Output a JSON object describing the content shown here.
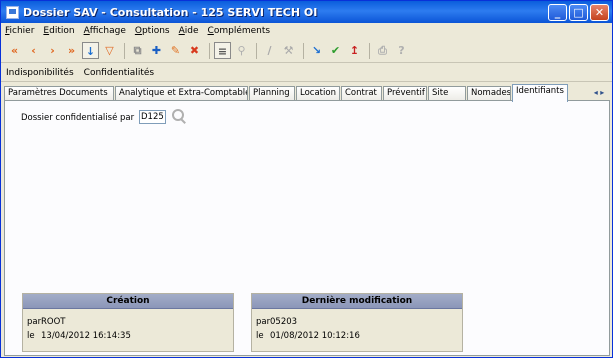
{
  "window": {
    "title": "Dossier SAV - Consultation - 125 SERVI TECH OI",
    "buttons": {
      "minimize": "_",
      "maximize": "□",
      "close": "✕"
    }
  },
  "menu": [
    "Fichier",
    "Edition",
    "Affichage",
    "Options",
    "Aide",
    "Compléments"
  ],
  "toolbar": {
    "icons": [
      "double-left-arrow-icon",
      "left-arrow-icon",
      "right-arrow-icon",
      "double-right-arrow-icon",
      "sort-icon",
      "filter-icon",
      "copy-icon",
      "add-icon",
      "edit-icon",
      "delete-icon",
      "list-icon",
      "lock-icon",
      "link-icon",
      "tools-icon",
      "validate-icon",
      "check-icon",
      "pin-icon",
      "print-icon",
      "help-icon"
    ],
    "glyphs": [
      "«",
      "‹",
      "›",
      "»",
      "↓",
      "▽",
      "⧉",
      "✚",
      "✎",
      "✖",
      "≡",
      "⚲",
      "∕",
      "⚒",
      "↘",
      "✔",
      "↥",
      "⎙",
      "?"
    ]
  },
  "subtabs": [
    "Indisponibilités",
    "Confidentialités"
  ],
  "tabs": [
    "Paramètres Documents",
    "Analytique et Extra-Comptable",
    "Planning",
    "Location",
    "Contrat",
    "Préventif",
    "Site",
    "Nomades",
    "Identifiants"
  ],
  "tab_scroll": "◂ ▸",
  "active_tab": "Identifiants",
  "form": {
    "confidential_label": "Dossier confidentialisé par",
    "confidential_value": "D125"
  },
  "creation": {
    "title": "Création",
    "par_label": "par",
    "par_value": "ROOT",
    "le_label": "le",
    "le_value": "13/04/2012 16:14:35"
  },
  "modification": {
    "title": "Dernière modification",
    "par_label": "par",
    "par_value": "05203",
    "le_label": "le",
    "le_value": "01/08/2012 10:12:16"
  },
  "colors": {
    "titlebar": "#0a5ddc",
    "toolbar_arrow": "#e0641c",
    "group_header": "#9aa4c2",
    "panel_bg": "#fcfcfe"
  }
}
